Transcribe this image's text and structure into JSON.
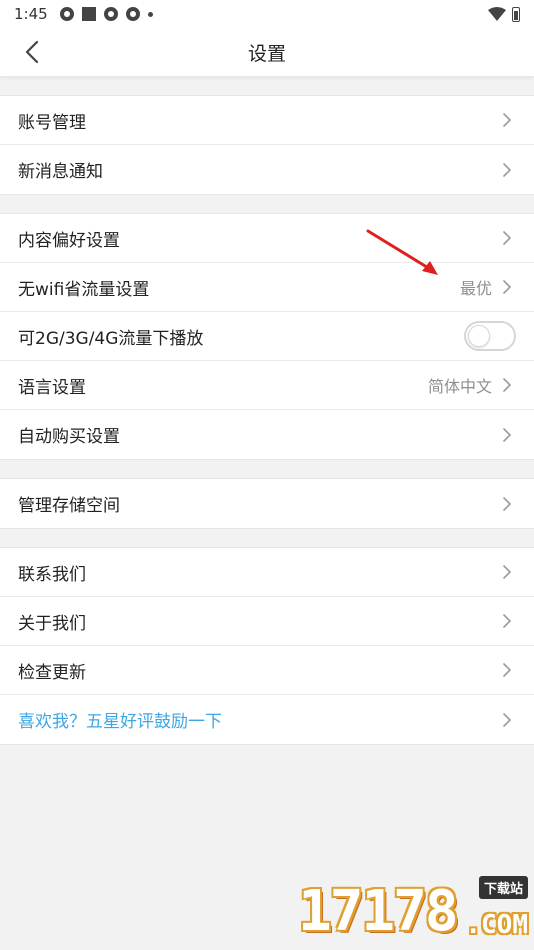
{
  "status": {
    "time": "1:45"
  },
  "nav": {
    "title": "设置"
  },
  "groups": [
    {
      "items": [
        {
          "label": "账号管理"
        },
        {
          "label": "新消息通知"
        }
      ]
    },
    {
      "items": [
        {
          "label": "内容偏好设置"
        },
        {
          "label": "无wifi省流量设置",
          "value": "最优"
        },
        {
          "label": "可2G/3G/4G流量下播放",
          "toggle": false
        },
        {
          "label": "语言设置",
          "value": "简体中文"
        },
        {
          "label": "自动购买设置"
        }
      ]
    },
    {
      "items": [
        {
          "label": "管理存储空间"
        }
      ]
    },
    {
      "items": [
        {
          "label": "联系我们"
        },
        {
          "label": "关于我们"
        },
        {
          "label": "检查更新"
        },
        {
          "label": "喜欢我？五星好评鼓励一下"
        }
      ]
    }
  ],
  "colors": {
    "accent": "#3da7e6",
    "annotation_arrow": "#e02020"
  },
  "watermark": {
    "number": "17178",
    "badge": "下载站",
    "domain": ".COM"
  },
  "icons": {
    "back": "chevron-left-icon",
    "row": "chevron-right-icon"
  }
}
